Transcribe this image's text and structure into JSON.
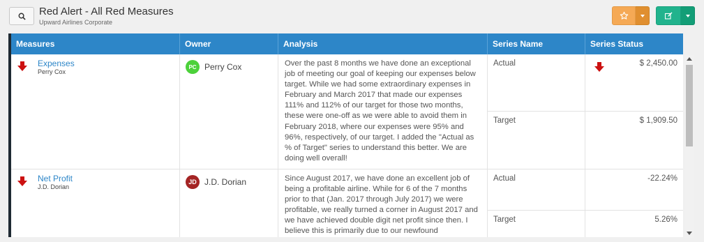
{
  "header": {
    "title": "Red Alert - All Red Measures",
    "subtitle": "Upward Airlines Corporate"
  },
  "colors": {
    "header_blue": "#2d86c8",
    "star_orange": "#f5a955",
    "edit_green": "#21b38d",
    "alert_red": "#cc1111"
  },
  "table": {
    "columns": [
      "Measures",
      "Owner",
      "Analysis",
      "Series Name",
      "Series Status"
    ],
    "rows": [
      {
        "measure": "Expenses",
        "measure_owner": "Perry Cox",
        "owner_initials": "PC",
        "owner_name": "Perry Cox",
        "analysis": "Over the past 8 months we have done an exceptional job of meeting our goal of keeping our expenses below target.  While we had some extraordinary expenses in February and March 2017 that made our expenses 111% and 112% of our target for those two months, these were one-off as we were able to avoid them in February 2018, where our expenses were 95% and 96%, respectively, of our target.  I added the \"Actual as % of Target\" series to understand this better. We are doing well overall!",
        "series": [
          {
            "name": "Actual",
            "status": "$ 2,450.00",
            "alert": true
          },
          {
            "name": "Target",
            "status": "$ 1,909.50",
            "alert": false
          }
        ]
      },
      {
        "measure": "Net Profit",
        "measure_owner": "J.D. Dorian",
        "owner_initials": "JD",
        "owner_name": "J.D. Dorian",
        "analysis": "Since August 2017, we have done an excellent job of being a profitable airline.  While for 6 of the 7 months prior to that (Jan. 2017 through July 2017) we were profitable, we really turned a corner in August 2017 and we have achieved double digit net profit since then.  I believe this is primarily due to our newfound",
        "series": [
          {
            "name": "Actual",
            "status": "-22.24%",
            "alert": false
          },
          {
            "name": "Target",
            "status": "5.26%",
            "alert": false
          }
        ]
      }
    ]
  }
}
